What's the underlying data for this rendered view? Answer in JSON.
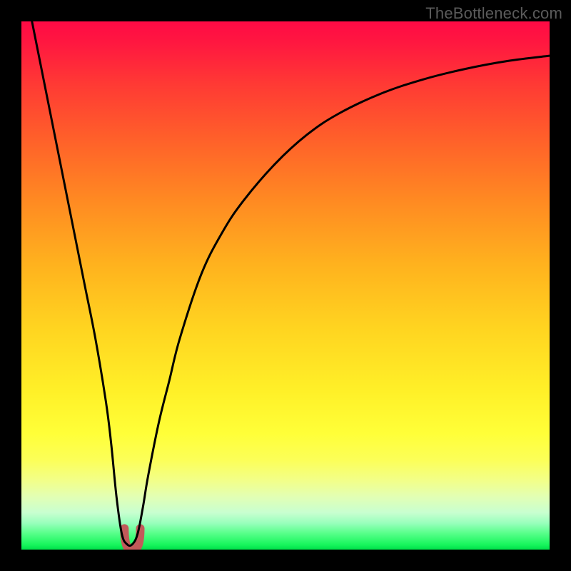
{
  "watermark": "TheBottleneck.com",
  "colors": {
    "frame": "#000000",
    "curve_stroke": "#000000",
    "valley_marker": "#c25a5a",
    "gradient_stops": [
      {
        "pct": 0,
        "hex": "#ff0a45"
      },
      {
        "pct": 22,
        "hex": "#ff5f2a"
      },
      {
        "pct": 46,
        "hex": "#ffb21e"
      },
      {
        "pct": 70,
        "hex": "#fff028"
      },
      {
        "pct": 90,
        "hex": "#e2ffb4"
      },
      {
        "pct": 100,
        "hex": "#00e04a"
      }
    ]
  },
  "chart_data": {
    "type": "line",
    "title": "",
    "xlabel": "",
    "ylabel": "",
    "xlim": [
      0,
      100
    ],
    "ylim": [
      0,
      100
    ],
    "series": [
      {
        "name": "bottleneck-curve",
        "x": [
          2,
          4,
          6,
          8,
          10,
          12,
          14,
          16,
          17,
          18,
          19,
          20,
          21,
          22,
          23,
          24,
          26,
          28,
          30,
          34,
          38,
          42,
          48,
          54,
          60,
          68,
          76,
          84,
          92,
          100
        ],
        "values": [
          100,
          90,
          80,
          70,
          60,
          50,
          40,
          28,
          20,
          10,
          3,
          1,
          1,
          3,
          8,
          14,
          24,
          32,
          40,
          52,
          60,
          66,
          73,
          78.5,
          82.5,
          86.3,
          89,
          91,
          92.5,
          93.5
        ]
      }
    ],
    "annotations": [
      {
        "name": "valley-marker",
        "x_range": [
          19.5,
          22.5
        ],
        "y_range": [
          0,
          4
        ],
        "shape": "U"
      }
    ]
  }
}
